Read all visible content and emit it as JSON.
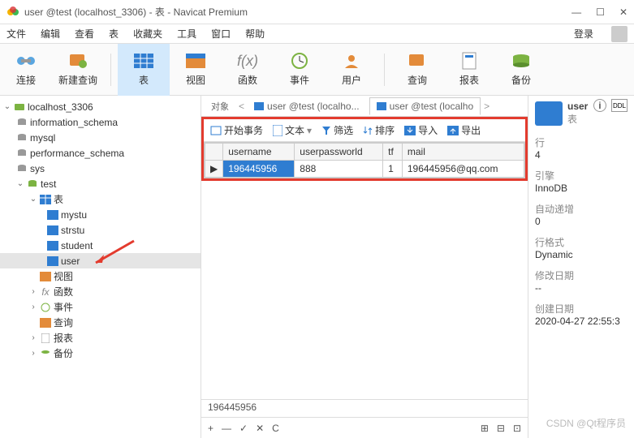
{
  "window": {
    "title": "user @test (localhost_3306) - 表 - Navicat Premium"
  },
  "menu": {
    "file": "文件",
    "edit": "编辑",
    "view": "查看",
    "table": "表",
    "favorites": "收藏夹",
    "tools": "工具",
    "window": "窗口",
    "help": "帮助",
    "login": "登录"
  },
  "toolbar": {
    "connect": "连接",
    "newquery": "新建查询",
    "table": "表",
    "view": "视图",
    "function": "函数",
    "event": "事件",
    "user": "用户",
    "query": "查询",
    "report": "报表",
    "backup": "备份"
  },
  "tree": {
    "conn": "localhost_3306",
    "dbs": [
      "information_schema",
      "mysql",
      "performance_schema",
      "sys"
    ],
    "testdb": "test",
    "tables_label": "表",
    "tables": [
      "mystu",
      "strstu",
      "student",
      "user"
    ],
    "view": "视图",
    "function": "函数",
    "event": "事件",
    "query": "查询",
    "report": "报表",
    "backup": "备份"
  },
  "tabs": {
    "object": "对象",
    "t1": "user @test (localho...",
    "t2": "user @test (localho"
  },
  "subtool": {
    "begin": "开始事务",
    "text": "文本",
    "filter": "筛选",
    "sort": "排序",
    "import": "导入",
    "export": "导出"
  },
  "grid": {
    "cols": [
      "username",
      "userpassworld",
      "tf",
      "mail"
    ],
    "row": [
      "196445956",
      "888",
      "1",
      "196445956@qq.com"
    ]
  },
  "status": {
    "value": "196445956"
  },
  "props": {
    "name": "user",
    "type": "表",
    "rows_label": "行",
    "rows": "4",
    "engine_label": "引擎",
    "engine": "InnoDB",
    "autoinc_label": "自动递增",
    "autoinc": "0",
    "rowfmt_label": "行格式",
    "rowfmt": "Dynamic",
    "modify_label": "修改日期",
    "modify": "--",
    "create_label": "创建日期",
    "create": "2020-04-27 22:55:3"
  },
  "watermark": "CSDN @Qt程序员"
}
